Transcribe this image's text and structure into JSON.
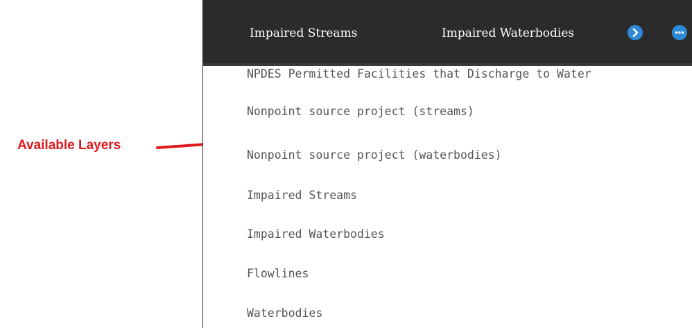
{
  "annotation": {
    "label": "Available Layers",
    "color": "#e0191c"
  },
  "tabs": [
    {
      "label": "Impaired Streams"
    },
    {
      "label": "Impaired Waterbodies"
    }
  ],
  "tab_controls": {
    "next_icon": "chevron-right-icon",
    "more_icon": "ellipsis-icon",
    "accent": "#2e8ad8"
  },
  "layers": [
    {
      "label": "NPDES Permitted Facilities that Discharge to Water"
    },
    {
      "label": "Nonpoint source project (streams)"
    },
    {
      "label": "Nonpoint source project (waterbodies)"
    },
    {
      "label": "Impaired Streams"
    },
    {
      "label": "Impaired Waterbodies"
    },
    {
      "label": "Flowlines"
    },
    {
      "label": "Waterbodies"
    }
  ],
  "colors": {
    "tab_bar_background": "#2b2b2b",
    "tab_text": "#ffffff",
    "list_text": "#555555"
  }
}
